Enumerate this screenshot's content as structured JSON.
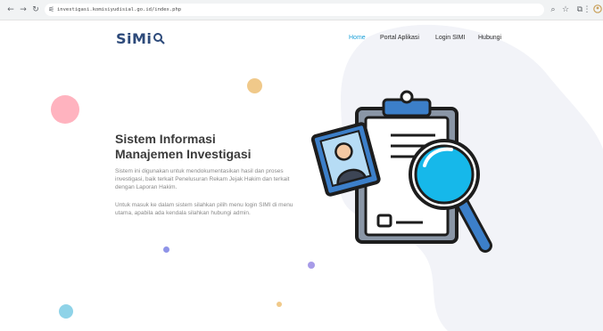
{
  "browser": {
    "url": "investigasi.komisiyudisial.go.id/index.php"
  },
  "site": {
    "logo": "SiMi",
    "menu": [
      {
        "label": "Home",
        "active": true
      },
      {
        "label": "Portal Aplikasi",
        "active": false
      },
      {
        "label": "Login SIMI",
        "active": false
      },
      {
        "label": "Hubungi",
        "active": false
      }
    ]
  },
  "hero": {
    "title_line1": "Sistem Informasi",
    "title_line2": "Manajemen Investigasi",
    "paragraph1": "Sistem ini digunakan untuk mendokumentasikan hasil dan proses investigasi, baik terkait Penelusuran Rekam Jejak Hakim dan terkait dengan Laporan Hakim.",
    "paragraph2": "Untuk masuk ke dalam sistem silahkan pilih menu login SIMI di menu utama, apabila ada kendala silahkan hubungi admin."
  },
  "colors": {
    "accent": "#1a9fd8",
    "logo": "#2d4a7a",
    "blob": "#f2f3f8"
  },
  "icons": {
    "back": "arrow-left-icon",
    "forward": "arrow-right-icon",
    "reload": "reload-icon",
    "site_info": "tune-icon",
    "zoom": "zoom-icon",
    "bookmark": "star-icon",
    "extensions": "puzzle-icon",
    "menu": "kebab-menu-icon",
    "profile": "profile-icon"
  }
}
